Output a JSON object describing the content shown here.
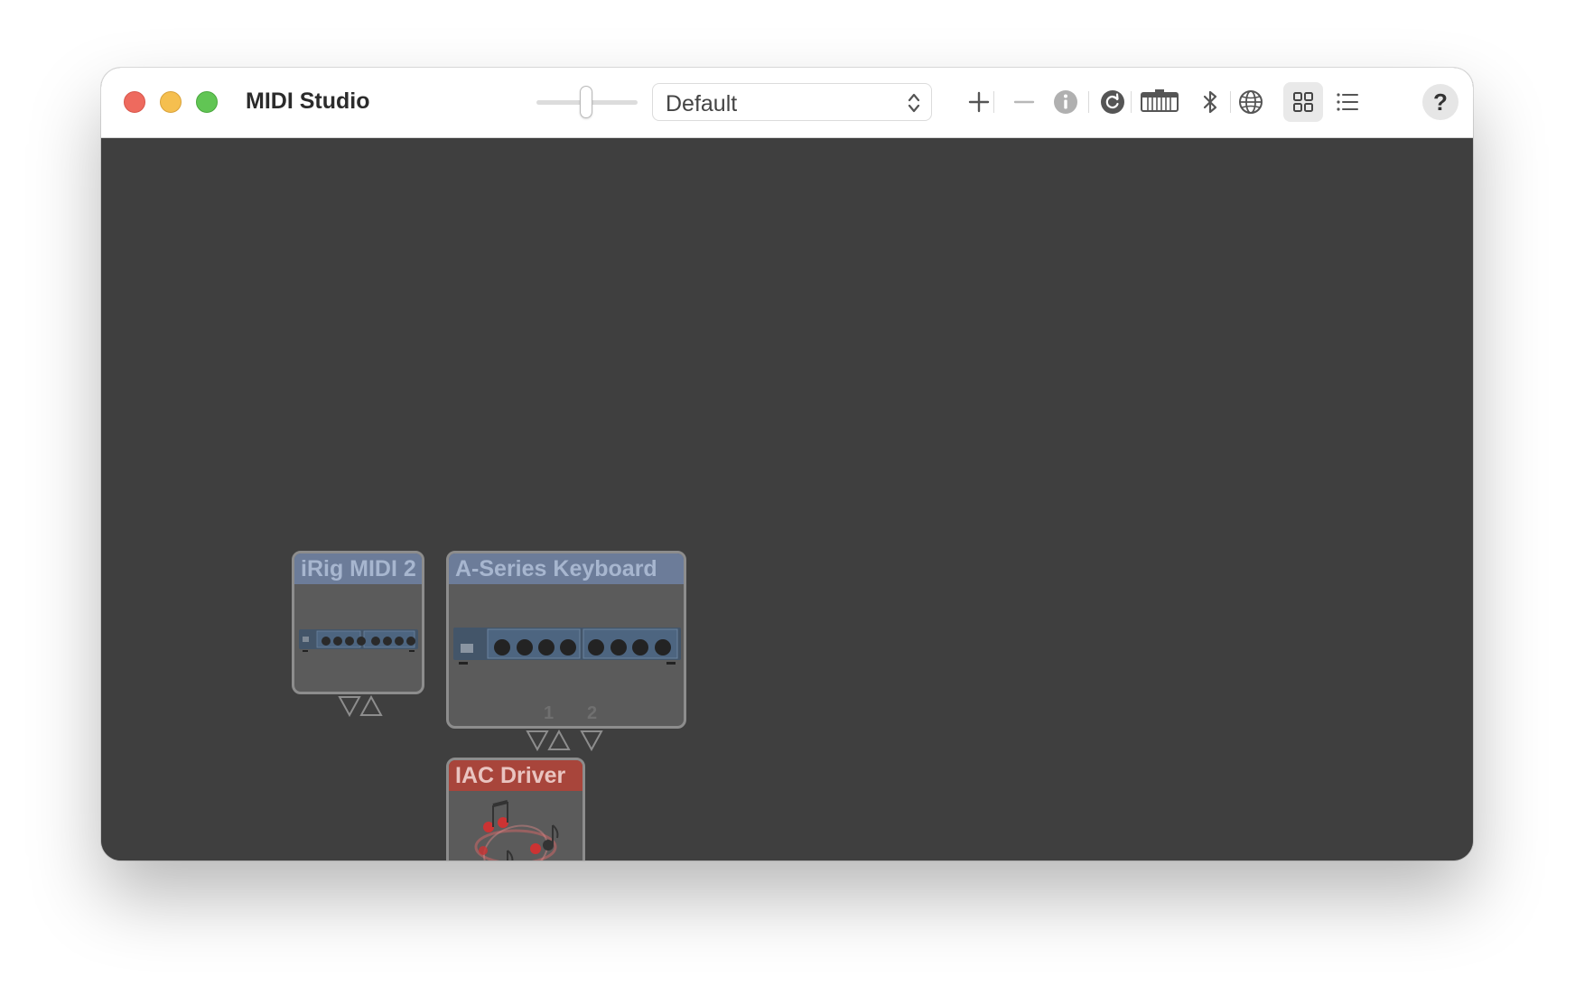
{
  "window": {
    "title": "MIDI Studio"
  },
  "toolbar": {
    "configuration_value": "Default",
    "help_label": "?",
    "icons": [
      "zoom-slider",
      "add-icon",
      "remove-icon",
      "info-icon",
      "rescan-icon",
      "test-setup-keyboard-icon",
      "bluetooth-icon",
      "network-icon",
      "grid-view-icon",
      "list-view-icon",
      "help-icon"
    ]
  },
  "devices": [
    {
      "name": "iRig MIDI 2",
      "color": "#6c7c99"
    },
    {
      "name": "A-Series Keyboard",
      "color": "#6c7c99",
      "ports": [
        "1",
        "2"
      ]
    },
    {
      "name": "IAC Driver",
      "color": "#a8453b"
    }
  ],
  "colors": {
    "canvas": "#3f3f3f",
    "close": "#ee6a5e",
    "minimize": "#f5bf4f",
    "maximize": "#61c554"
  }
}
